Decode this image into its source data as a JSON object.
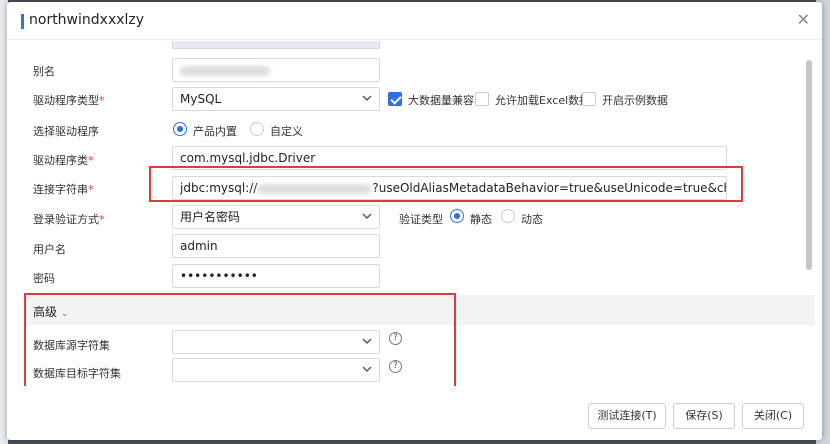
{
  "dialog": {
    "title": "northwindxxxlzy",
    "close_icon": "close-icon"
  },
  "form": {
    "alias": {
      "label": "别名",
      "value": ""
    },
    "driver_type": {
      "label": "驱动程序类型",
      "required": "*",
      "value": "MySQL",
      "big_data_compat": {
        "label": "大数据量兼容",
        "checked": true
      },
      "allow_excel": {
        "label": "允许加载Excel数据",
        "checked": false
      },
      "enable_sample": {
        "label": "开启示例数据",
        "checked": false
      }
    },
    "select_driver": {
      "label": "选择驱动程序",
      "options": [
        {
          "label": "产品内置",
          "selected": true
        },
        {
          "label": "自定义",
          "selected": false
        }
      ]
    },
    "driver_class": {
      "label": "驱动程序类",
      "required": "*",
      "value": "com.mysql.jdbc.Driver"
    },
    "connection_string": {
      "label": "连接字符串",
      "required": "*",
      "value_prefix": "jdbc:mysql://",
      "value_suffix": "?useOldAliasMetadataBehavior=true&useUnicode=true&characterEncoding"
    },
    "auth_mode": {
      "label": "登录验证方式",
      "required": "*",
      "value": "用户名密码",
      "verify_type_label": "验证类型",
      "options": [
        {
          "label": "静态",
          "selected": true
        },
        {
          "label": "动态",
          "selected": false
        }
      ]
    },
    "username": {
      "label": "用户名",
      "value": "admin"
    },
    "password": {
      "label": "密码",
      "value": "•••••••••••"
    }
  },
  "advanced": {
    "label": "高级",
    "source_charset": {
      "label": "数据库源字符集",
      "value": ""
    },
    "target_charset": {
      "label": "数据库目标字符集",
      "value": ""
    },
    "help_glyph": "?"
  },
  "footer": {
    "test_button": "测试连接(T)",
    "save_button": "保存(S)",
    "close_button": "关闭(C)"
  },
  "colors": {
    "accent": "#2f6fe0",
    "highlight_box": "#e0393e",
    "required": "#e33"
  }
}
